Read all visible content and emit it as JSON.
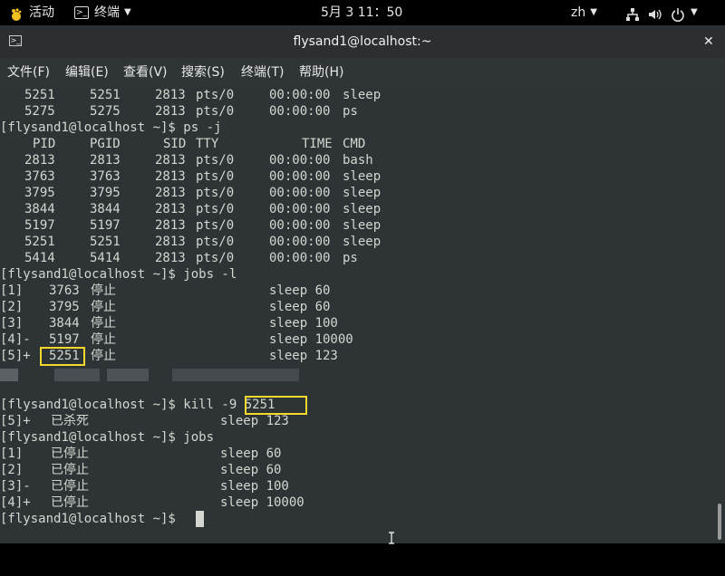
{
  "topbar": {
    "activities": "活动",
    "app_name": "终端",
    "clock": "5月 3  11：50",
    "lang": "zh"
  },
  "titlebar": {
    "title": "flysand1@localhost:~"
  },
  "menubar": {
    "items": [
      "文件(F)",
      "编辑(E)",
      "查看(V)",
      "搜索(S)",
      "终端(T)",
      "帮助(H)"
    ]
  },
  "terminal": {
    "lines": [
      {
        "c": [
          "5251",
          "5251",
          "2813",
          "pts/0",
          "00:00:00",
          "sleep"
        ]
      },
      {
        "c": [
          "5275",
          "5275",
          "2813",
          "pts/0",
          "00:00:00",
          "ps"
        ]
      },
      {
        "c": [
          "[flysand1@localhost ~]$ ps -j"
        ]
      },
      {
        "c": [
          "PID",
          "PGID",
          "SID",
          "TTY",
          "TIME",
          "CMD"
        ]
      },
      {
        "c": [
          "2813",
          "2813",
          "2813",
          "pts/0",
          "00:00:00",
          "bash"
        ]
      },
      {
        "c": [
          "3763",
          "3763",
          "2813",
          "pts/0",
          "00:00:00",
          "sleep"
        ]
      },
      {
        "c": [
          "3795",
          "3795",
          "2813",
          "pts/0",
          "00:00:00",
          "sleep"
        ]
      },
      {
        "c": [
          "3844",
          "3844",
          "2813",
          "pts/0",
          "00:00:00",
          "sleep"
        ]
      },
      {
        "c": [
          "5197",
          "5197",
          "2813",
          "pts/0",
          "00:00:00",
          "sleep"
        ]
      },
      {
        "c": [
          "5251",
          "5251",
          "2813",
          "pts/0",
          "00:00:00",
          "sleep"
        ]
      },
      {
        "c": [
          "5414",
          "5414",
          "2813",
          "pts/0",
          "00:00:00",
          "ps"
        ]
      },
      {
        "c": [
          "[flysand1@localhost ~]$ jobs -l"
        ]
      },
      {
        "c": [
          "[1]",
          "3763",
          "停止",
          "sleep 60"
        ]
      },
      {
        "c": [
          "[2]",
          "3795",
          "停止",
          "sleep 60"
        ]
      },
      {
        "c": [
          "[3]",
          "3844",
          "停止",
          "sleep 100"
        ]
      },
      {
        "c": [
          "[4]-",
          "5197",
          "停止",
          "sleep 10000"
        ]
      },
      {
        "c": [
          "[5]+",
          "5251",
          "停止",
          "sleep 123"
        ]
      },
      {
        "c": []
      },
      {
        "c": [
          "[flysand1@localhost ~]$ kill -9 5251"
        ]
      },
      {
        "c": [
          "[5]+",
          "已杀死",
          "sleep 123"
        ]
      },
      {
        "c": [
          "[flysand1@localhost ~]$ jobs"
        ]
      },
      {
        "c": [
          "[1]",
          "已停止",
          "sleep 60"
        ]
      },
      {
        "c": [
          "[2]",
          "已停止",
          "sleep 60"
        ]
      },
      {
        "c": [
          "[3]-",
          "已停止",
          "sleep 100"
        ]
      },
      {
        "c": [
          "[4]+",
          "已停止",
          "sleep 10000"
        ]
      },
      {
        "c": [
          "[flysand1@localhost ~]$ "
        ]
      }
    ]
  }
}
